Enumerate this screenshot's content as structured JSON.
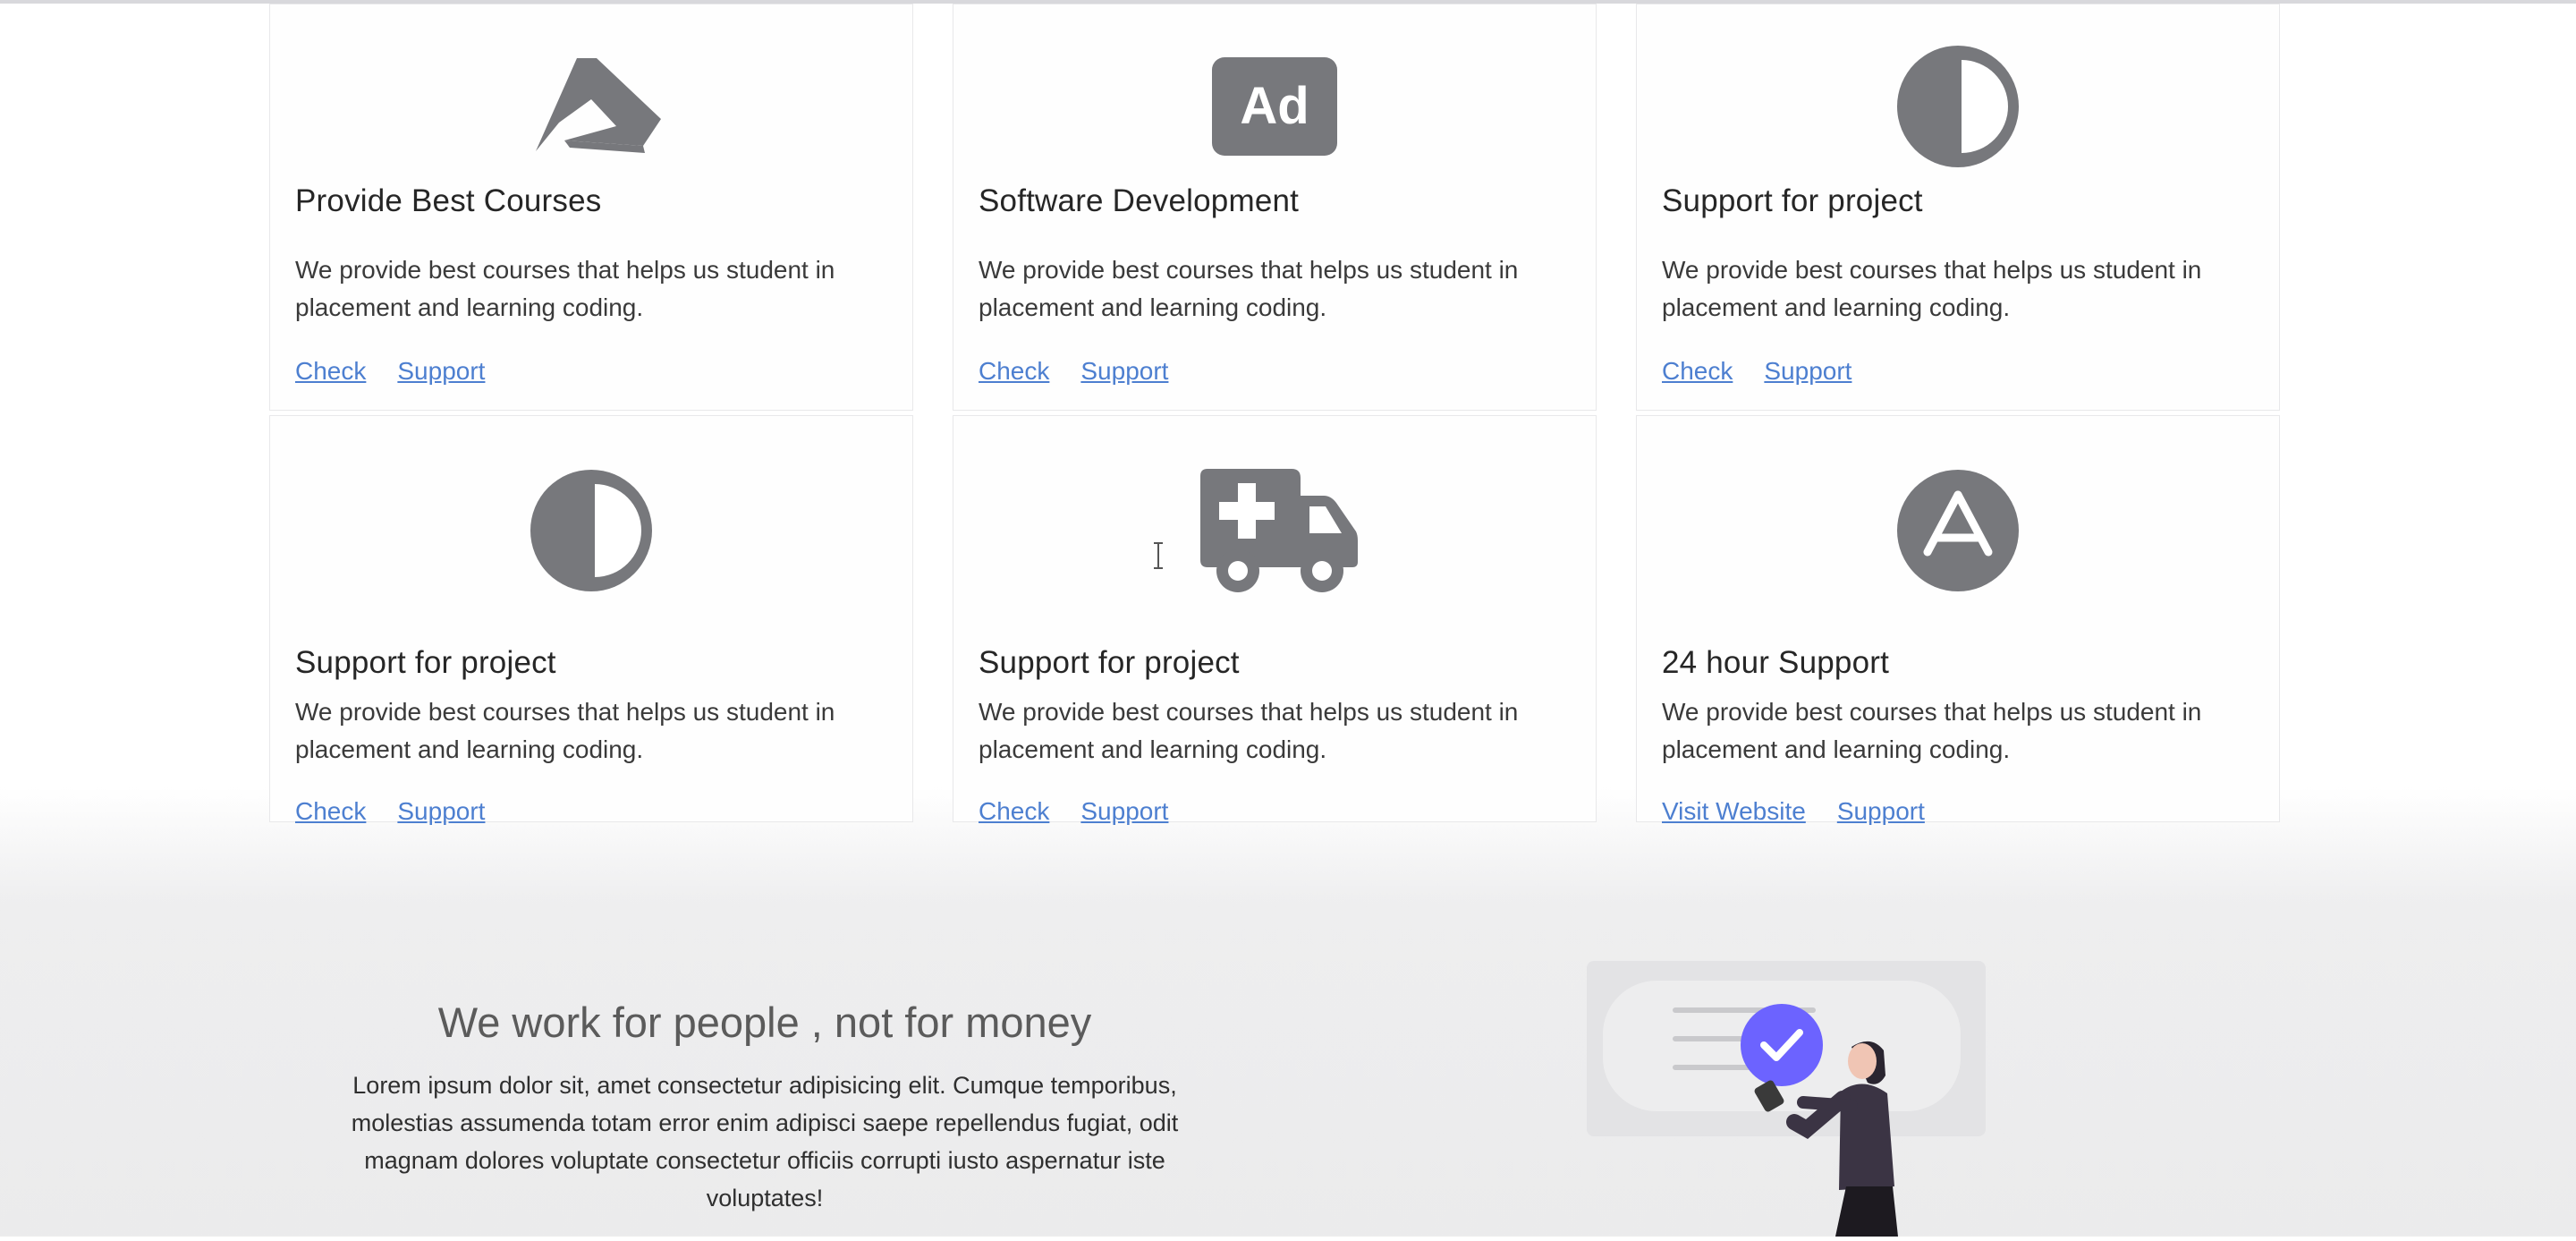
{
  "cards": [
    {
      "icon": "avianex-logo-icon",
      "title": "Provide Best Courses",
      "text": "We provide best courses that helps us student in placement and learning coding.",
      "link1": "Check",
      "link2": "Support"
    },
    {
      "icon": "ad-icon",
      "title": "Software Development",
      "text": "We provide best courses that helps us student in placement and learning coding.",
      "link1": "Check",
      "link2": "Support"
    },
    {
      "icon": "adjust-contrast-icon",
      "title": "Support for project",
      "text": "We provide best courses that helps us student in placement and learning coding.",
      "link1": "Check",
      "link2": "Support"
    },
    {
      "icon": "adjust-contrast-icon",
      "title": "Support for project",
      "text": "We provide best courses that helps us student in placement and learning coding.",
      "link1": "Check",
      "link2": "Support"
    },
    {
      "icon": "ambulance-icon",
      "title": "Support for project",
      "text": "We provide best courses that helps us student in placement and learning coding.",
      "link1": "Check",
      "link2": "Support"
    },
    {
      "icon": "app-store-logo-icon",
      "title": "24 hour Support",
      "text": "We provide best courses that helps us student in placement and learning coding.",
      "link1": "Visit Website",
      "link2": "Support"
    }
  ],
  "hero": {
    "title": "We work for people , not for money",
    "body": "Lorem ipsum dolor sit, amet consectetur adipisicing elit. Cumque temporibus, molestias assumenda totam error enim adipisci saepe repellendus fugiat, odit magnam dolores voluptate consectetur officiis corrupti iusto aspernatur iste voluptates!"
  },
  "colors": {
    "icon_gray": "#77787c",
    "link_blue": "#4d7fd0",
    "check_purple": "#6c63ff"
  }
}
